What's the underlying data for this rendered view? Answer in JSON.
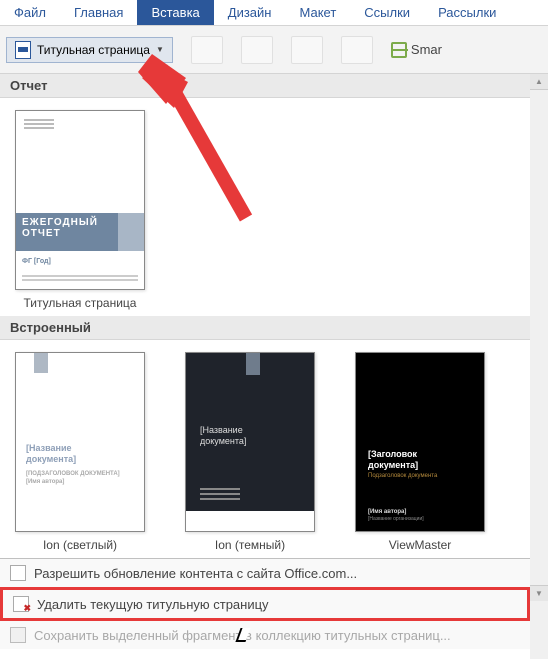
{
  "tabs": {
    "file": "Файл",
    "home": "Главная",
    "insert": "Вставка",
    "design": "Дизайн",
    "layout": "Макет",
    "references": "Ссылки",
    "mailings": "Рассылки"
  },
  "ribbon": {
    "title_page_btn": "Титульная страница",
    "smartart": "Smar"
  },
  "groups": {
    "report": "Отчет",
    "builtin": "Встроенный"
  },
  "templates": {
    "report": {
      "label": "Титульная страница",
      "band1": "ЕЖЕГОДНЫЙ",
      "band2": "ОТЧЕТ",
      "meta": "ФГ [Год]"
    },
    "ion_light": {
      "label": "Ion (светлый)",
      "title1": "[Название",
      "title2": "документа]",
      "meta1": "[ПОДЗАГОЛОВОК ДОКУМЕНТА]",
      "meta2": "[Имя автора]"
    },
    "ion_dark": {
      "label": "Ion (темный)",
      "title1": "[Название",
      "title2": "документа]"
    },
    "viewmaster": {
      "label": "ViewMaster",
      "title1": "[Заголовок",
      "title2": "документа]",
      "sub": "Подзаголовок документа",
      "foot1": "[Имя автора]",
      "foot2": "[Название организации]"
    }
  },
  "menu": {
    "update": "Разрешить обновление контента с сайта Office.com...",
    "delete": "Удалить текущую титульную страницу",
    "save": "Сохранить выделенный фрагмент в коллекцию титульных страниц..."
  },
  "colors": {
    "word_blue": "#2b579a",
    "highlight_red": "#e63939"
  }
}
